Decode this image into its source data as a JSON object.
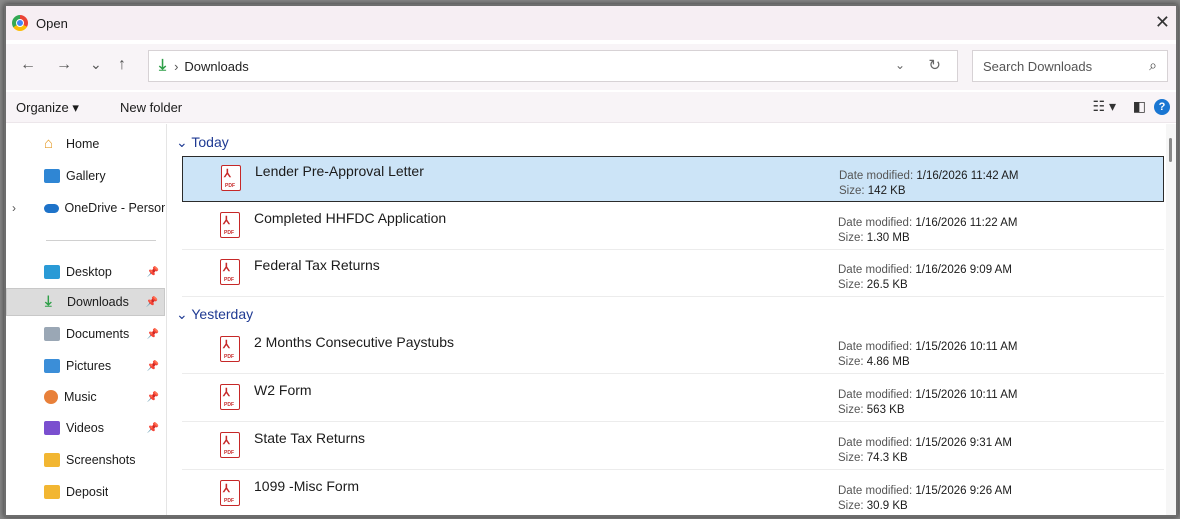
{
  "window": {
    "title": "Open"
  },
  "nav": {
    "back": "←",
    "forward": "→",
    "recent": "⌄",
    "up": "↑",
    "breadcrumb_sep": "›",
    "breadcrumb": "Downloads",
    "address_chevron": "⌄",
    "refresh": "↻",
    "search_placeholder": "Search Downloads"
  },
  "toolbar": {
    "organize": "Organize ▾",
    "new_folder": "New folder",
    "view_options": "☷ ▾",
    "preview_pane": "◧",
    "help": "?"
  },
  "sidebar": {
    "items": [
      {
        "label": "Home",
        "pinned": false
      },
      {
        "label": "Gallery",
        "pinned": false
      },
      {
        "label": "OneDrive - Persona",
        "pinned": false
      },
      {
        "label": "Desktop",
        "pinned": true
      },
      {
        "label": "Downloads",
        "pinned": true,
        "selected": true
      },
      {
        "label": "Documents",
        "pinned": true
      },
      {
        "label": "Pictures",
        "pinned": true
      },
      {
        "label": "Music",
        "pinned": true
      },
      {
        "label": "Videos",
        "pinned": true
      },
      {
        "label": "Screenshots",
        "pinned": false
      },
      {
        "label": "Deposit",
        "pinned": false
      }
    ]
  },
  "labels": {
    "date_modified": "Date modified:",
    "size": "Size:",
    "pdf": "PDF",
    "pdf_symbol": "⅄"
  },
  "groups": [
    {
      "title": "Today",
      "files": [
        {
          "name": "Lender Pre-Approval Letter",
          "modified": "1/16/2026 11:42 AM",
          "size": "142 KB",
          "selected": true
        },
        {
          "name": "Completed HHFDC Application",
          "modified": "1/16/2026 11:22 AM",
          "size": "1.30 MB"
        },
        {
          "name": "Federal Tax Returns",
          "modified": "1/16/2026 9:09 AM",
          "size": "26.5 KB"
        }
      ]
    },
    {
      "title": "Yesterday",
      "files": [
        {
          "name": "2 Months Consecutive Paystubs",
          "modified": "1/15/2026 10:11 AM",
          "size": "4.86 MB"
        },
        {
          "name": "W2 Form",
          "modified": "1/15/2026 10:11 AM",
          "size": "563 KB"
        },
        {
          "name": "State Tax Returns",
          "modified": "1/15/2026 9:31 AM",
          "size": "74.3 KB"
        },
        {
          "name": "1099 -Misc Form",
          "modified": "1/15/2026 9:26 AM",
          "size": "30.9 KB"
        }
      ]
    }
  ],
  "colors": {
    "accent": "#2e9f48",
    "selection": "#cce4f7",
    "group_header": "#1f3a93",
    "pdf_red": "#c62828"
  }
}
